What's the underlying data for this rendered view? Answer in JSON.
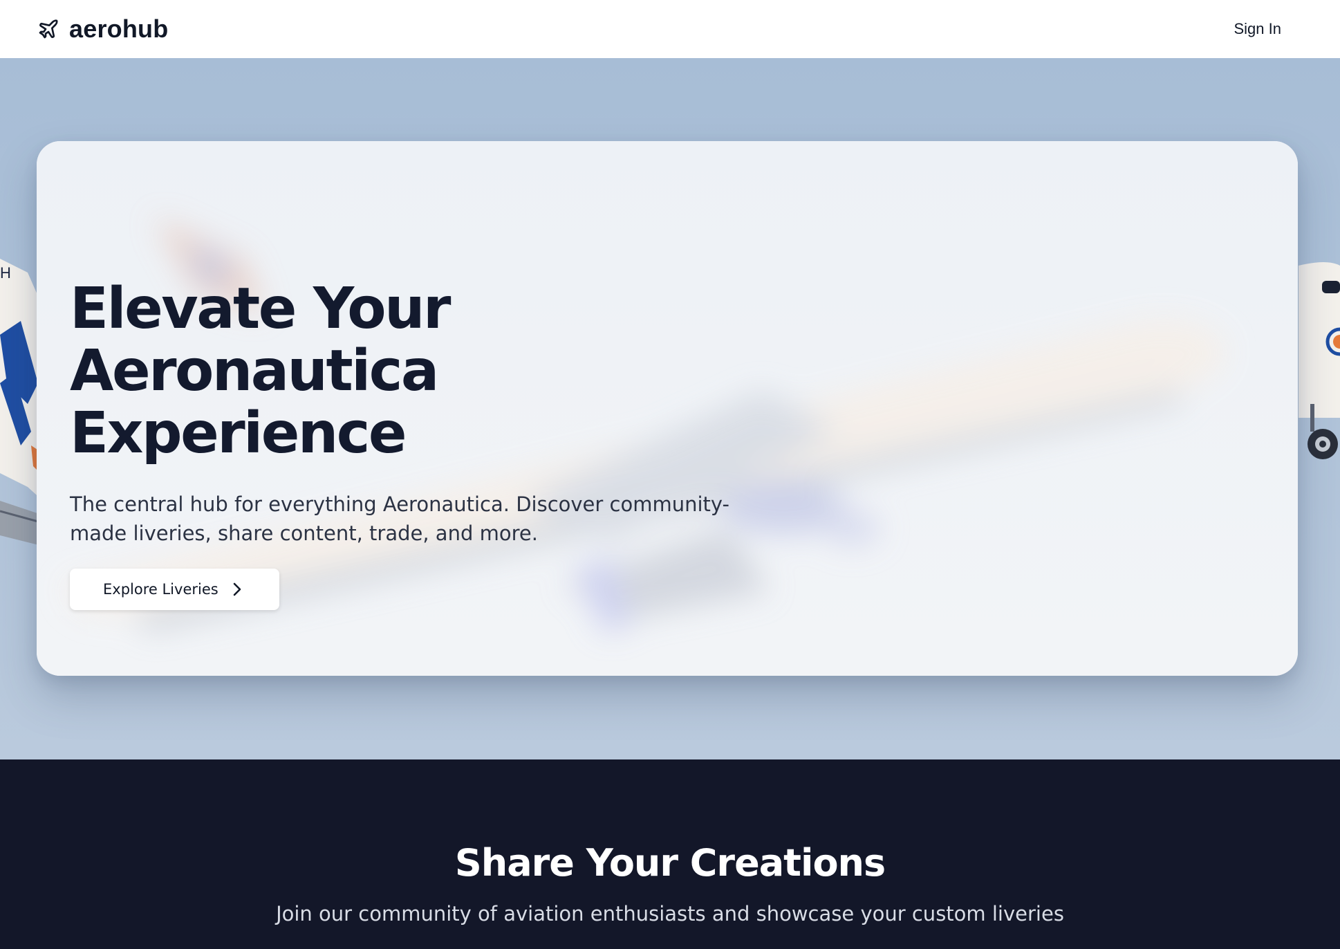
{
  "header": {
    "brand": "aerohub",
    "brand_icon": "plane-icon",
    "signin_label": "Sign In"
  },
  "hero": {
    "title_line1": "Elevate Your Aeronautica",
    "title_line2": "Experience",
    "subtitle": "The central hub for everything Aeronautica. Discover community-made liveries, share content, trade, and more.",
    "cta_label": "Explore Liveries",
    "cta_icon": "chevron-right-icon"
  },
  "share": {
    "title": "Share Your Creations",
    "subtitle": "Join our community of aviation enthusiasts and showcase your custom liveries"
  },
  "colors": {
    "hero_bg": "#a8bed6",
    "dark_bg": "#131729",
    "text_dark": "#131a2e",
    "accent_blue": "#1f4ea3"
  }
}
